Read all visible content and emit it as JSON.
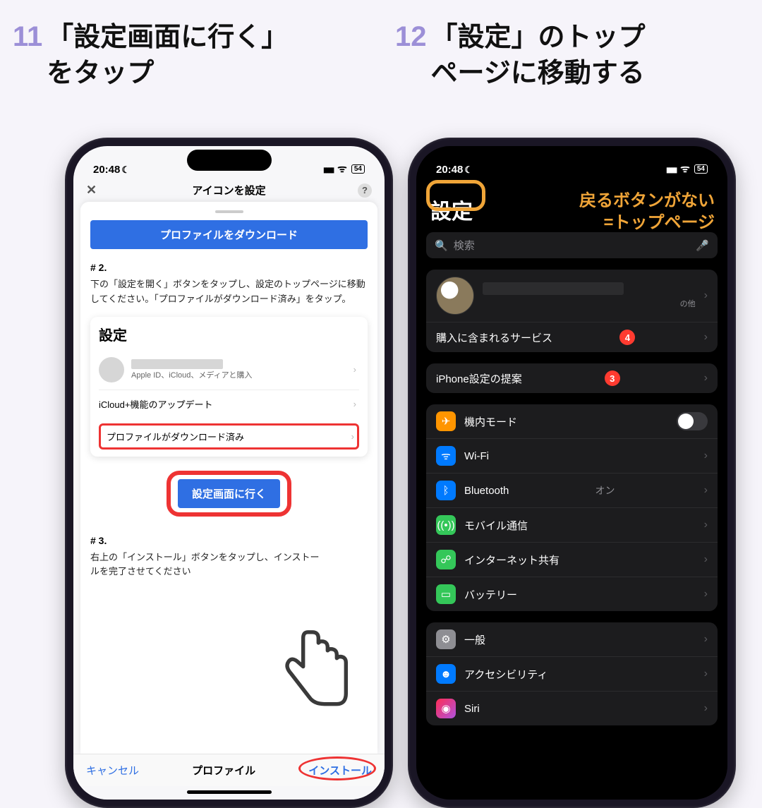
{
  "step11": {
    "num": "11",
    "text": "「設定画面に行く」\nをタップ"
  },
  "step12": {
    "num": "12",
    "text": "「設定」のトップ\nページに移動する"
  },
  "status": {
    "time": "20:48",
    "battery": "54"
  },
  "phone1": {
    "header": "アイコンを設定",
    "downloadBtn": "プロファイルをダウンロード",
    "s2num": "# 2.",
    "s2text": "下の「設定を開く」ボタンをタップし、設定のトップページに移動してください。「プロファイルがダウンロード済み」をタップ。",
    "previewTitle": "設定",
    "previewSub": "Apple ID、iCloud、メディアと購入",
    "icloudRow": "iCloud+機能のアップデート",
    "dlRow": "プロファイルがダウンロード済み",
    "goBtn": "設定画面に行く",
    "s3num": "# 3.",
    "s3text": "右上の「インストール」ボタンをタップし、インストールを完了させてください",
    "cancel": "キャンセル",
    "title": "プロファイル",
    "install": "インストール"
  },
  "phone2": {
    "title": "設定",
    "searchPlaceholder": "検索",
    "profileSuffix": "の他",
    "purchase": "購入に含まれるサービス",
    "purchaseBadge": "4",
    "suggest": "iPhone設定の提案",
    "suggestBadge": "3",
    "items": [
      {
        "label": "機内モード",
        "icon": "ic-air",
        "glyph": "✈",
        "toggle": true
      },
      {
        "label": "Wi-Fi",
        "icon": "ic-wifi",
        "glyph": "ᯤ",
        "value": ""
      },
      {
        "label": "Bluetooth",
        "icon": "ic-bt",
        "glyph": "ᛒ",
        "value": "オン"
      },
      {
        "label": "モバイル通信",
        "icon": "ic-cell",
        "glyph": "((•))"
      },
      {
        "label": "インターネット共有",
        "icon": "ic-hot",
        "glyph": "☍"
      },
      {
        "label": "バッテリー",
        "icon": "ic-bat",
        "glyph": "▭"
      }
    ],
    "items2": [
      {
        "label": "一般",
        "icon": "ic-gen",
        "glyph": "⚙"
      },
      {
        "label": "アクセシビリティ",
        "icon": "ic-acc",
        "glyph": "☻"
      },
      {
        "label": "Siri",
        "icon": "ic-siri",
        "glyph": "◉"
      }
    ],
    "annoLine1": "戻るボタンがない",
    "annoLine2": "=トップページ"
  }
}
